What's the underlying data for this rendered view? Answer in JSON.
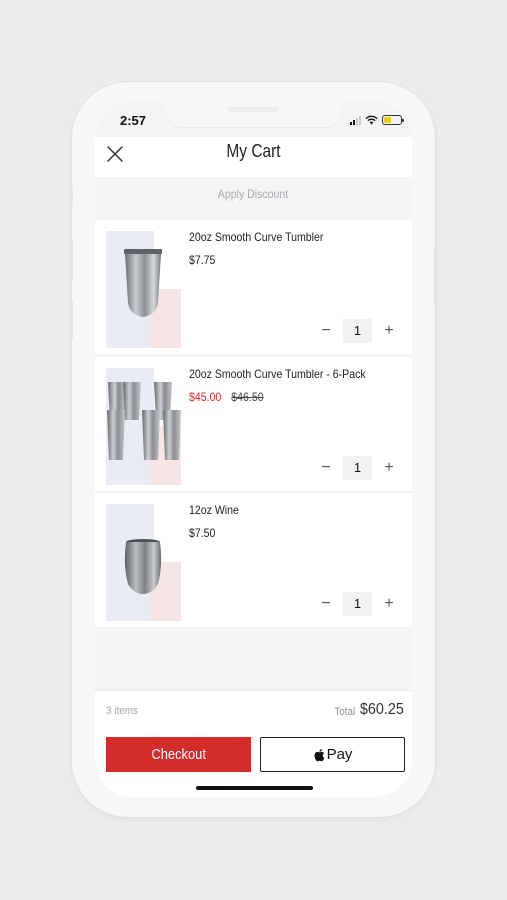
{
  "status_bar": {
    "time": "2:57"
  },
  "header": {
    "title": "My Cart",
    "close_icon": "close-icon"
  },
  "discount": {
    "label": "Apply Discount"
  },
  "cart": {
    "items": [
      {
        "name": "20oz Smooth Curve Tumbler",
        "price": "$7.75",
        "original_price": "",
        "quantity": "1",
        "decrement": "−",
        "increment": "+"
      },
      {
        "name": "20oz Smooth Curve Tumbler - 6-Pack",
        "price": "$45.00",
        "original_price": "$46.50",
        "quantity": "1",
        "decrement": "−",
        "increment": "+"
      },
      {
        "name": "12oz Wine",
        "price": "$7.50",
        "original_price": "",
        "quantity": "1",
        "decrement": "−",
        "increment": "+"
      }
    ]
  },
  "footer": {
    "item_count": "3 items",
    "total_label": "Total",
    "total_value": "$60.25",
    "checkout_label": "Checkout",
    "apple_pay_label": "Pay"
  },
  "colors": {
    "accent": "#d42b2b",
    "sale_price": "#d8282c",
    "battery": "#f2cc1d"
  }
}
